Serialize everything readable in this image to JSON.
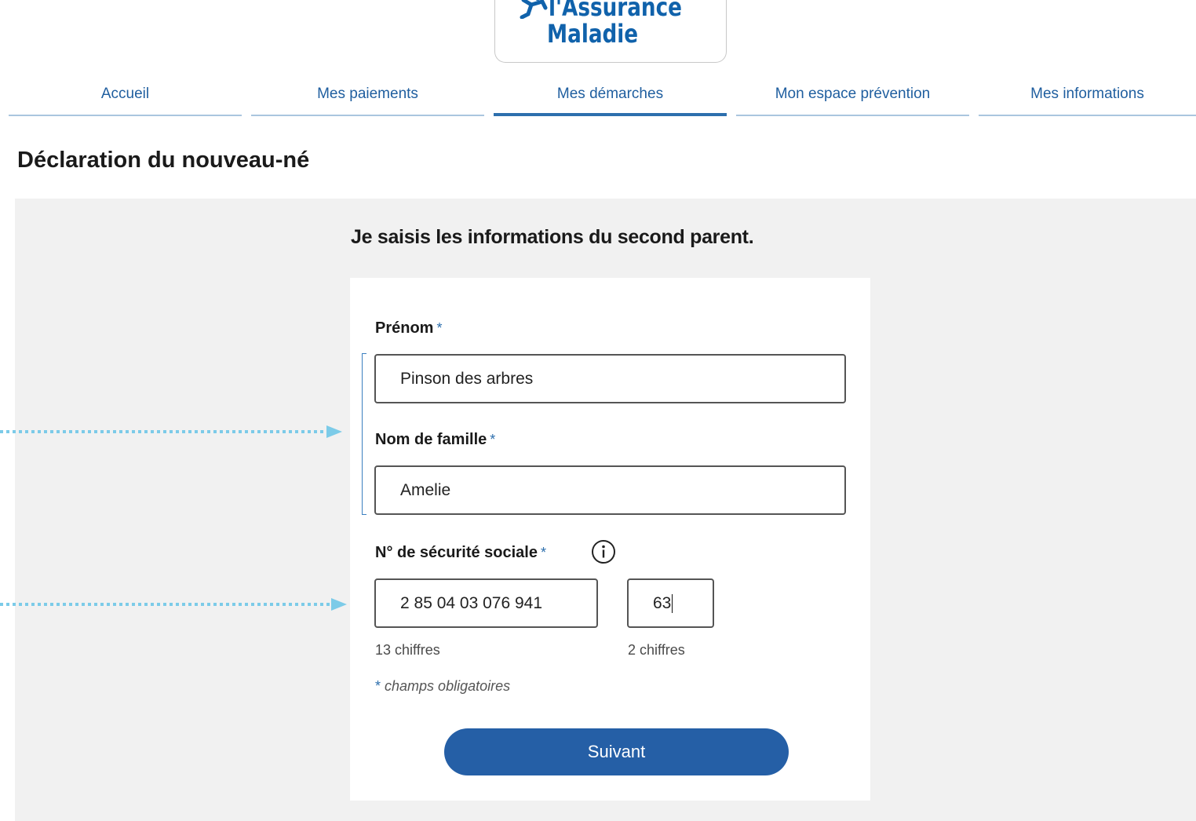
{
  "logo": {
    "line1": "l'Assurance",
    "line2": "Maladie",
    "brand_color": "#1062ab"
  },
  "nav": {
    "items": [
      {
        "label": "Accueil",
        "active": false
      },
      {
        "label": "Mes paiements",
        "active": false
      },
      {
        "label": "Mes démarches",
        "active": true
      },
      {
        "label": "Mon espace prévention",
        "active": false
      },
      {
        "label": "Mes informations",
        "active": false
      }
    ]
  },
  "page": {
    "title": "Déclaration du nouveau-né"
  },
  "form": {
    "heading": "Je saisis les informations du second parent.",
    "first_name": {
      "label": "Prénom",
      "required_mark": "*",
      "value": "Pinson des arbres"
    },
    "last_name": {
      "label": "Nom de famille",
      "required_mark": "*",
      "value": "Amelie"
    },
    "ssn": {
      "label": "N° de sécurité sociale",
      "required_mark": "*",
      "info_icon": "info-icon",
      "number_value": "2 85 04 03 076 941",
      "number_hint": "13 chiffres",
      "key_value": "63",
      "key_hint": "2 chiffres"
    },
    "required_note_star": "*",
    "required_note": "champs obligatoires",
    "submit_label": "Suivant"
  },
  "colors": {
    "accent": "#255fa6",
    "nav_text": "#1f5e9f",
    "panel_bg": "#f1f1f1",
    "annotation_arrow": "#7ccbe8"
  }
}
